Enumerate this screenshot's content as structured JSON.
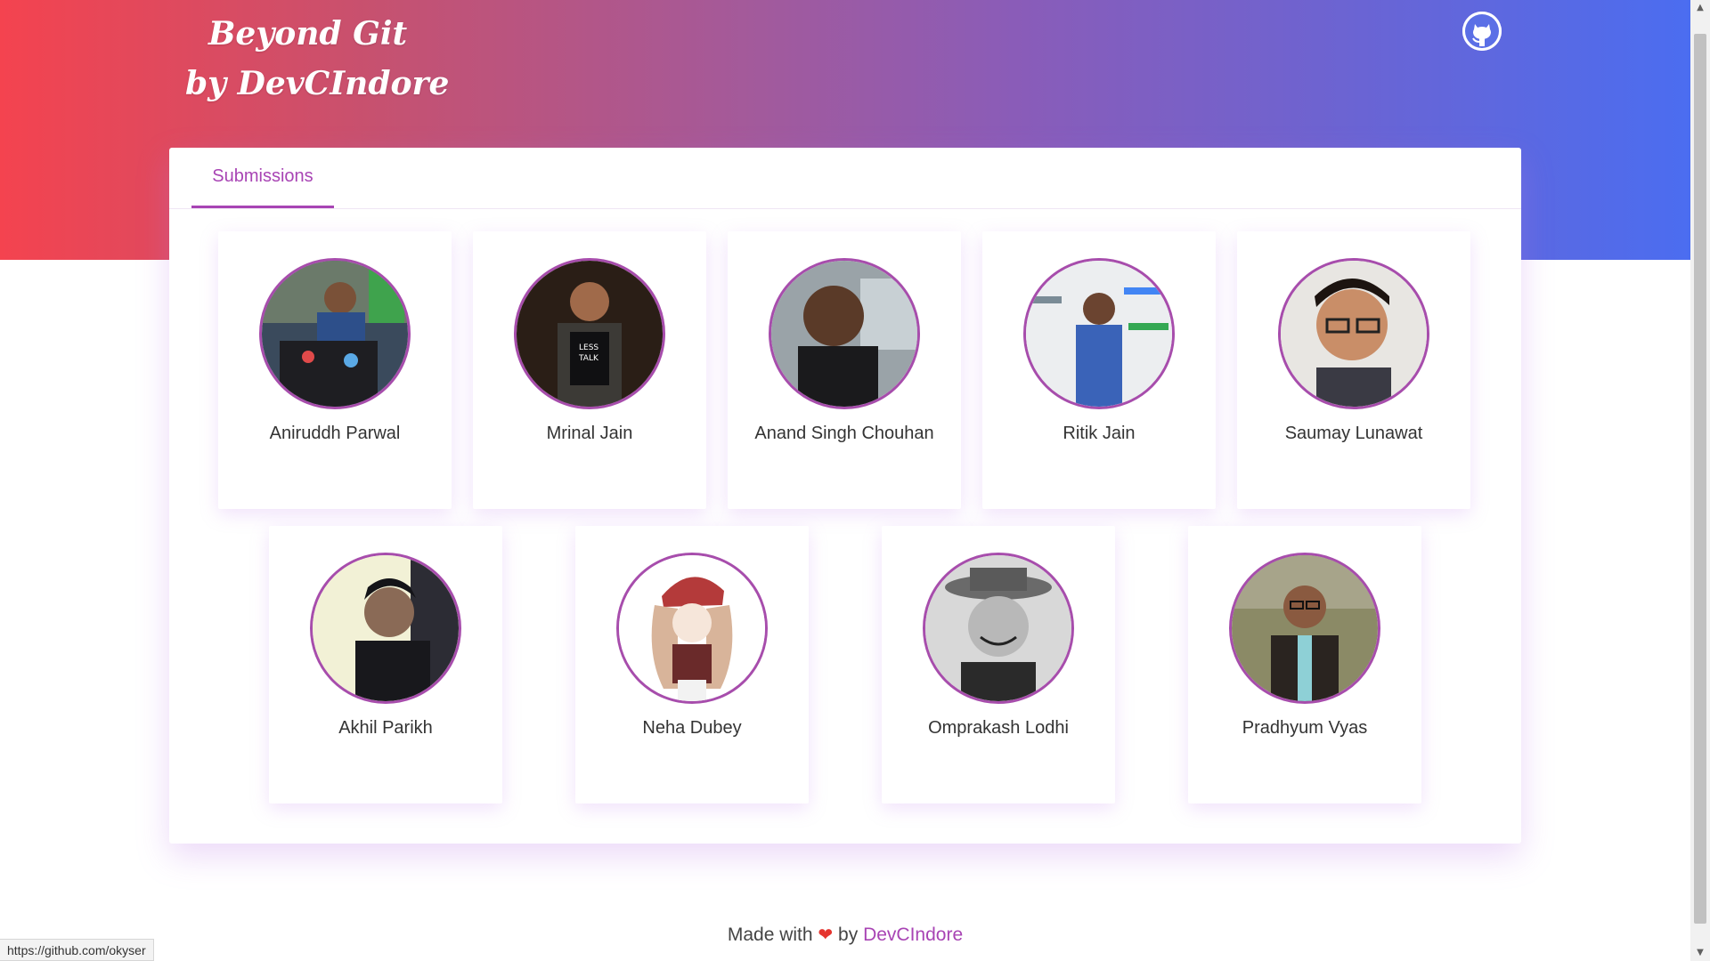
{
  "header": {
    "brand_line1": "Beyond Git",
    "brand_line2": "by DevCIndore",
    "github_icon": "github-icon"
  },
  "tabs": [
    {
      "label": "Submissions"
    }
  ],
  "people": [
    {
      "name": "Aniruddh Parwal"
    },
    {
      "name": "Mrinal Jain"
    },
    {
      "name": "Anand Singh Chouhan"
    },
    {
      "name": "Ritik Jain"
    },
    {
      "name": "Saumay Lunawat"
    },
    {
      "name": "Akhil Parikh"
    },
    {
      "name": "Neha Dubey"
    },
    {
      "name": "Omprakash Lodhi"
    },
    {
      "name": "Pradhyum Vyas"
    }
  ],
  "footer": {
    "prefix": "Made with",
    "by": "by",
    "link": "DevCIndore"
  },
  "status_bar": {
    "url": "https://github.com/okyser"
  },
  "colors": {
    "accent": "#a844b4",
    "gradient_start": "#f4434f",
    "gradient_end": "#4b6df0",
    "heart": "#e5352f"
  }
}
